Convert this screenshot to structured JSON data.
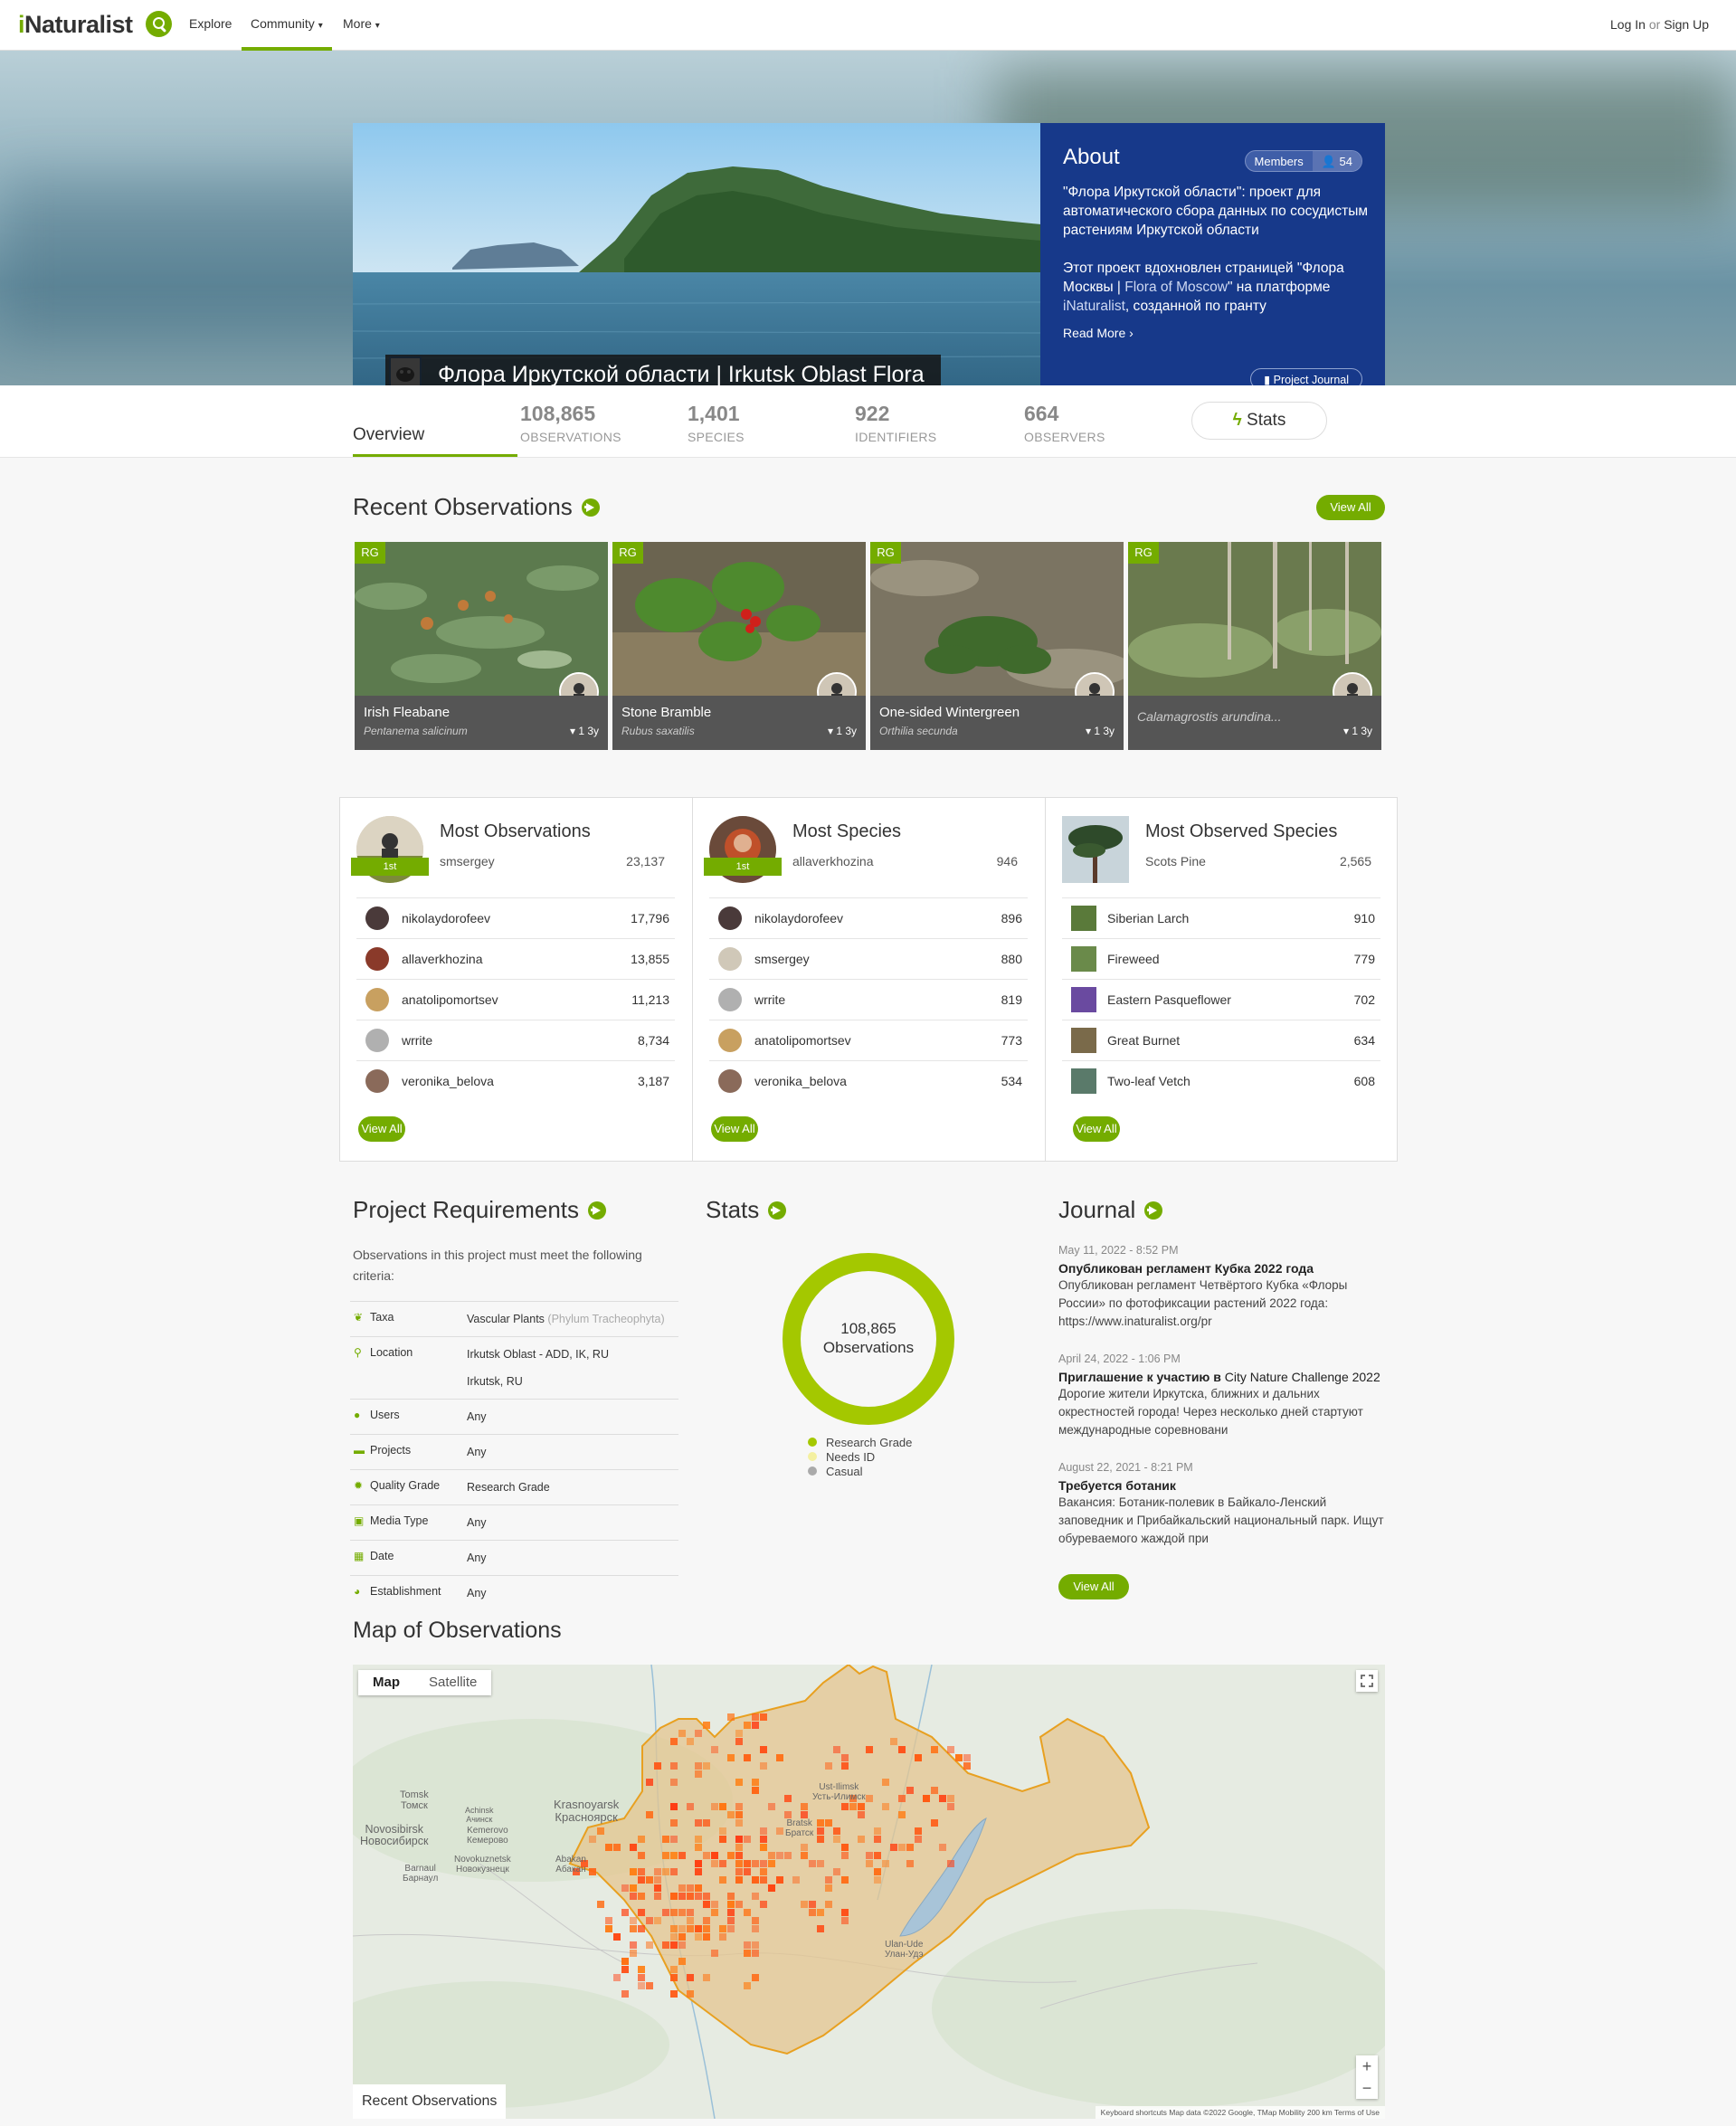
{
  "nav": {
    "logo_i": "i",
    "logo_rest": "Naturalist",
    "explore": "Explore",
    "community": "Community",
    "more": "More",
    "login": "Log In",
    "or": "or",
    "signup": "Sign Up"
  },
  "project": {
    "title": "Флора Иркутской области | Irkutsk Oblast Flora"
  },
  "about": {
    "title": "About",
    "members_label": "Members",
    "members_count": "54",
    "para1": "\"Флора Иркутской области\": проект для автоматического сбора данных по сосудистым растениям Иркутской области",
    "para2_a": "Этот проект вдохновлен страницей \"Флора Москвы | ",
    "para2_link": "Flora of Moscow",
    "para2_b": "\" на платформе ",
    "para2_c": "iNaturalist",
    "para2_d": ", созданной по гранту",
    "read_more": "Read More",
    "journal_btn": "Project Journal"
  },
  "stats": {
    "overview": "Overview",
    "observations": {
      "num": "108,865",
      "label": "OBSERVATIONS"
    },
    "species": {
      "num": "1,401",
      "label": "SPECIES"
    },
    "identifiers": {
      "num": "922",
      "label": "IDENTIFIERS"
    },
    "observers": {
      "num": "664",
      "label": "OBSERVERS"
    },
    "stats_btn": "Stats"
  },
  "recent": {
    "title": "Recent Observations",
    "view_all": "View All",
    "items": [
      {
        "badge": "RG",
        "name": "Irish Fleabane",
        "sci": "Pentanema salicinum",
        "meta": "1  3y"
      },
      {
        "badge": "RG",
        "name": "Stone Bramble",
        "sci": "Rubus saxatilis",
        "meta": "1  3y"
      },
      {
        "badge": "RG",
        "name": "One-sided Wintergreen",
        "sci": "Orthilia secunda",
        "meta": "1  3y"
      },
      {
        "badge": "RG",
        "name": "",
        "sci": "Calamagrostis arundina...",
        "meta": "1  3y"
      }
    ]
  },
  "boards": {
    "most_obs": {
      "title": "Most Observations",
      "ribbon": "1st",
      "leader": "smsergey",
      "leader_val": "23,137",
      "rows": [
        {
          "name": "nikolaydorofeev",
          "val": "17,796"
        },
        {
          "name": "allaverkhozina",
          "val": "13,855"
        },
        {
          "name": "anatolipomortsev",
          "val": "11,213"
        },
        {
          "name": "wrrite",
          "val": "8,734"
        },
        {
          "name": "veronika_belova",
          "val": "3,187"
        }
      ],
      "view_all": "View All"
    },
    "most_species": {
      "title": "Most Species",
      "ribbon": "1st",
      "leader": "allaverkhozina",
      "leader_val": "946",
      "rows": [
        {
          "name": "nikolaydorofeev",
          "val": "896"
        },
        {
          "name": "smsergey",
          "val": "880"
        },
        {
          "name": "wrrite",
          "val": "819"
        },
        {
          "name": "anatolipomortsev",
          "val": "773"
        },
        {
          "name": "veronika_belova",
          "val": "534"
        }
      ],
      "view_all": "View All"
    },
    "most_observed": {
      "title": "Most Observed Species",
      "leader": "Scots Pine",
      "leader_val": "2,565",
      "rows": [
        {
          "name": "Siberian Larch",
          "val": "910"
        },
        {
          "name": "Fireweed",
          "val": "779"
        },
        {
          "name": "Eastern Pasqueflower",
          "val": "702"
        },
        {
          "name": "Great Burnet",
          "val": "634"
        },
        {
          "name": "Two-leaf Vetch",
          "val": "608"
        }
      ],
      "view_all": "View All"
    }
  },
  "requirements": {
    "title": "Project Requirements",
    "intro": "Observations in this project must meet the following criteria:",
    "taxa_k": "Taxa",
    "taxa_v": "Vascular Plants",
    "taxa_sub": "(Phylum Tracheophyta)",
    "location_k": "Location",
    "location_v1": "Irkutsk Oblast - ADD, IK, RU",
    "location_v2": "Irkutsk, RU",
    "users_k": "Users",
    "users_v": "Any",
    "projects_k": "Projects",
    "projects_v": "Any",
    "quality_k": "Quality Grade",
    "quality_v": "Research Grade",
    "media_k": "Media Type",
    "media_v": "Any",
    "date_k": "Date",
    "date_v": "Any",
    "est_k": "Establishment",
    "est_v": "Any"
  },
  "stats_section": {
    "title": "Stats",
    "donut_num": "108,865",
    "donut_label": "Observations",
    "legend": [
      {
        "label": "Research Grade",
        "color": "#a4c800"
      },
      {
        "label": "Needs ID",
        "color": "#f4f0a0"
      },
      {
        "label": "Casual",
        "color": "#aaaaaa"
      }
    ],
    "chart_data": {
      "type": "pie",
      "categories": [
        "Research Grade",
        "Needs ID",
        "Casual"
      ],
      "values": [
        100,
        0,
        0
      ]
    }
  },
  "journal": {
    "title": "Journal",
    "view_all": "View All",
    "entries": [
      {
        "date": "May 11, 2022 - 8:52 PM",
        "title": "Опубликован регламент Кубка 2022 года",
        "body": "Опубликован регламент Четвёртого Кубка «Флоры России» по фотофиксации растений 2022 года: https://www.inaturalist.org/pr"
      },
      {
        "date": "April 24, 2022 - 1:06 PM",
        "title_a": "Приглашение к участию в ",
        "title_b": "City Nature Challenge 2022",
        "body": "Дорогие жители Иркутска, ближних и дальних окрестностей города! Через несколько дней стартуют международные соревновани"
      },
      {
        "date": "August 22, 2021 - 8:21 PM",
        "title": "Требуется ботаник",
        "body": "Вакансия: Ботаник-полевик в Байкало-Ленский заповедник и Прибайкальский национальный парк. Ищут обуреваемого жаждой при"
      }
    ]
  },
  "map": {
    "title": "Map of Observations",
    "tab_map": "Map",
    "tab_satellite": "Satellite",
    "recent": "Recent Observations",
    "zoom_in": "+",
    "zoom_out": "−",
    "footer": "Keyboard shortcuts    Map data ©2022 Google, TMap Mobility    200 km    Terms of Use",
    "cities": [
      {
        "en": "Tomsk",
        "ru": "Томск"
      },
      {
        "en": "Krasnoyarsk",
        "ru": "Красноярск"
      },
      {
        "en": "Achinsk",
        "ru": "Ачинск"
      },
      {
        "en": "Novosibirsk",
        "ru": "Новосибирск"
      },
      {
        "en": "Kemerovo",
        "ru": "Кемерово"
      },
      {
        "en": "Novokuznetsk",
        "ru": "Новокузнецк"
      },
      {
        "en": "Barnaul",
        "ru": "Барнаул"
      },
      {
        "en": "Abakan",
        "ru": "Абакан"
      },
      {
        "en": "Bratsk",
        "ru": "Братск"
      },
      {
        "en": "Ust-Ilimsk",
        "ru": "Усть-Илимск"
      },
      {
        "en": "Ulan-Ude",
        "ru": "Улан-Удэ"
      }
    ]
  }
}
